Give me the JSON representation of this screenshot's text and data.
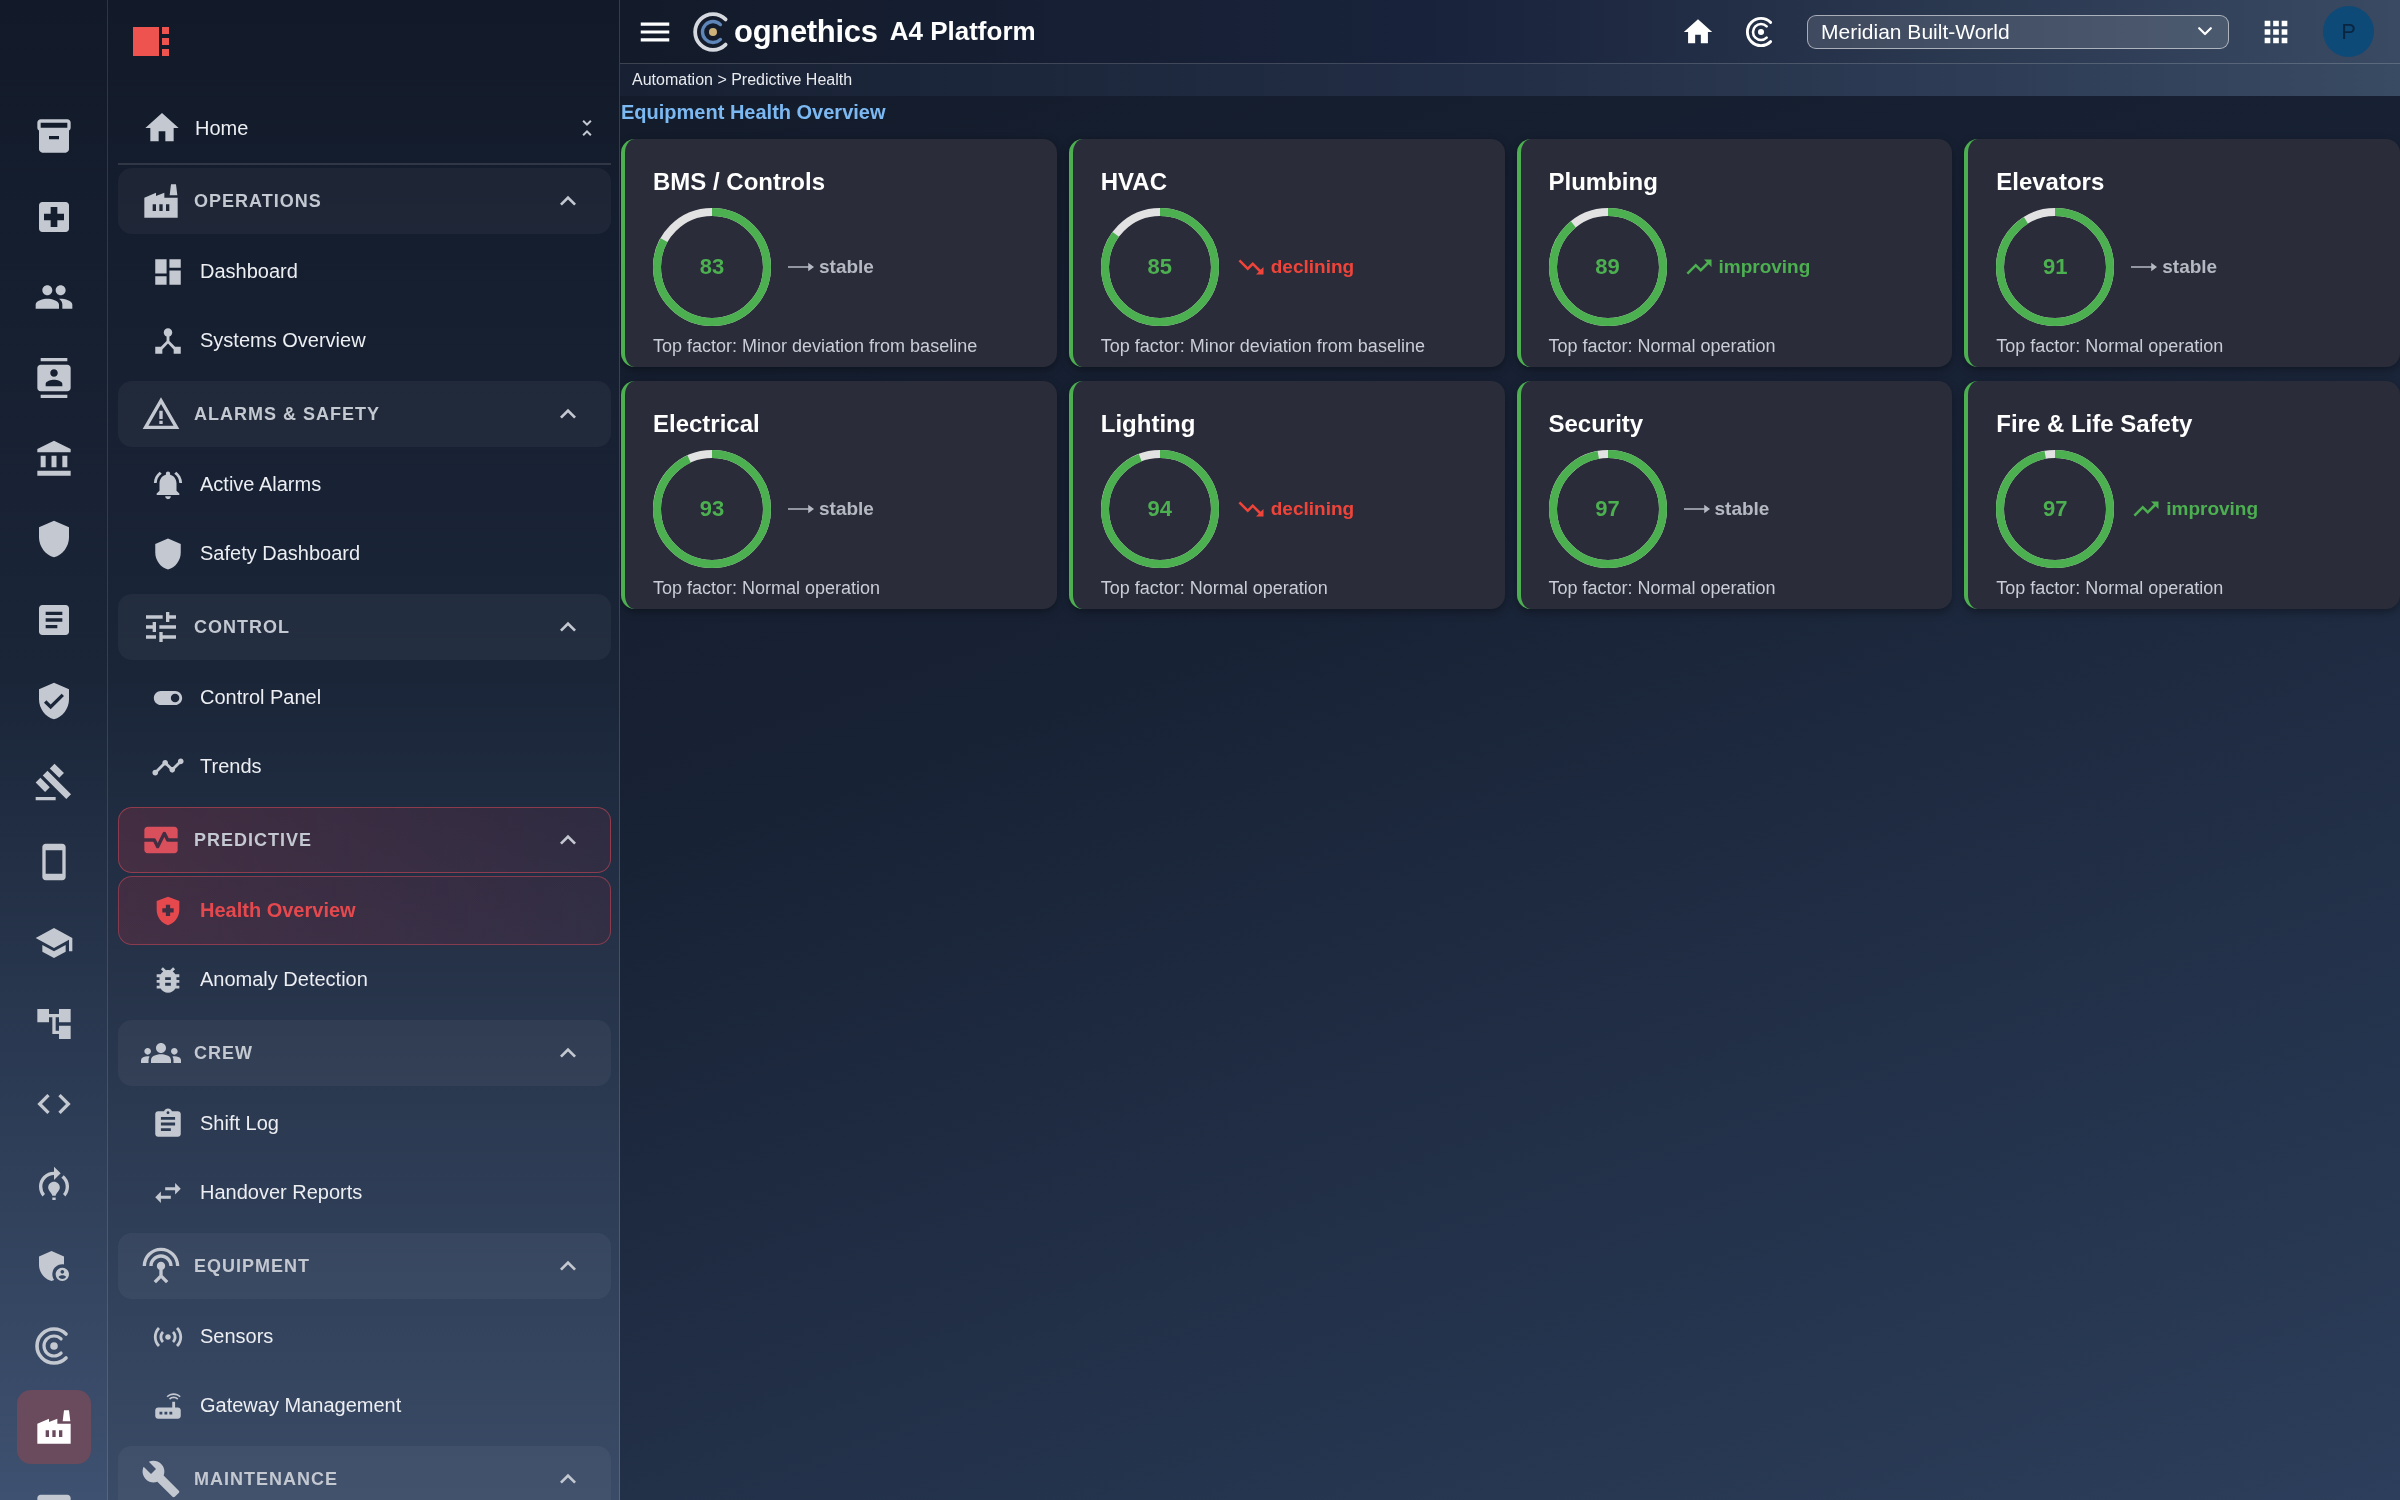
{
  "icon_rail": {
    "items": [
      {
        "selected": false
      },
      {
        "selected": false
      },
      {
        "selected": false
      },
      {
        "selected": false
      },
      {
        "selected": false
      },
      {
        "selected": false
      },
      {
        "selected": false
      },
      {
        "selected": false
      },
      {
        "selected": false
      },
      {
        "selected": false
      },
      {
        "selected": false
      },
      {
        "selected": false
      },
      {
        "selected": false
      },
      {
        "selected": false
      },
      {
        "selected": false
      },
      {
        "selected": false
      },
      {
        "selected": true
      },
      {
        "selected": false
      }
    ]
  },
  "sidebar": {
    "home": {
      "label": "Home"
    },
    "sections": [
      {
        "label": "OPERATIONS",
        "expanded": true,
        "active": false,
        "items": [
          {
            "label": "Dashboard",
            "selected": false
          },
          {
            "label": "Systems Overview",
            "selected": false
          }
        ]
      },
      {
        "label": "ALARMS & SAFETY",
        "expanded": true,
        "active": false,
        "items": [
          {
            "label": "Active Alarms",
            "selected": false
          },
          {
            "label": "Safety Dashboard",
            "selected": false
          }
        ]
      },
      {
        "label": "CONTROL",
        "expanded": true,
        "active": false,
        "items": [
          {
            "label": "Control Panel",
            "selected": false
          },
          {
            "label": "Trends",
            "selected": false
          }
        ]
      },
      {
        "label": "PREDICTIVE",
        "expanded": true,
        "active": true,
        "items": [
          {
            "label": "Health Overview",
            "selected": true
          },
          {
            "label": "Anomaly Detection",
            "selected": false
          }
        ]
      },
      {
        "label": "CREW",
        "expanded": true,
        "active": false,
        "items": [
          {
            "label": "Shift Log",
            "selected": false
          },
          {
            "label": "Handover Reports",
            "selected": false
          }
        ]
      },
      {
        "label": "EQUIPMENT",
        "expanded": true,
        "active": false,
        "items": [
          {
            "label": "Sensors",
            "selected": false
          },
          {
            "label": "Gateway Management",
            "selected": false
          }
        ]
      },
      {
        "label": "MAINTENANCE",
        "expanded": true,
        "active": false
      }
    ]
  },
  "top_bar": {
    "brand": "ognethics",
    "product": "A4 Platform",
    "site_selector": {
      "value": "Meridian Built-World"
    },
    "user": {
      "initial": "P"
    }
  },
  "breadcrumb": "Automation > Predictive Health",
  "page_title": "Equipment Health Overview",
  "cards": [
    {
      "title": "BMS / Controls",
      "score": "83",
      "level": 0.83,
      "trend": {
        "kind": "stable",
        "label": "stable"
      },
      "top_factor": "Top factor: Minor deviation from baseline"
    },
    {
      "title": "HVAC",
      "score": "85",
      "level": 0.85,
      "trend": {
        "kind": "declining",
        "label": "declining"
      },
      "top_factor": "Top factor: Minor deviation from baseline"
    },
    {
      "title": "Plumbing",
      "score": "89",
      "level": 0.89,
      "trend": {
        "kind": "improving",
        "label": "improving"
      },
      "top_factor": "Top factor: Normal operation"
    },
    {
      "title": "Elevators",
      "score": "91",
      "level": 0.91,
      "trend": {
        "kind": "stable",
        "label": "stable"
      },
      "top_factor": "Top factor: Normal operation"
    },
    {
      "title": "Electrical",
      "score": "93",
      "level": 0.93,
      "trend": {
        "kind": "stable",
        "label": "stable"
      },
      "top_factor": "Top factor: Normal operation"
    },
    {
      "title": "Lighting",
      "score": "94",
      "level": 0.94,
      "trend": {
        "kind": "declining",
        "label": "declining"
      },
      "top_factor": "Top factor: Normal operation"
    },
    {
      "title": "Security",
      "score": "97",
      "level": 0.97,
      "trend": {
        "kind": "stable",
        "label": "stable"
      },
      "top_factor": "Top factor: Normal operation"
    },
    {
      "title": "Fire & Life Safety",
      "score": "97",
      "level": 0.97,
      "trend": {
        "kind": "improving",
        "label": "improving"
      },
      "top_factor": "Top factor: Normal operation"
    }
  ]
}
